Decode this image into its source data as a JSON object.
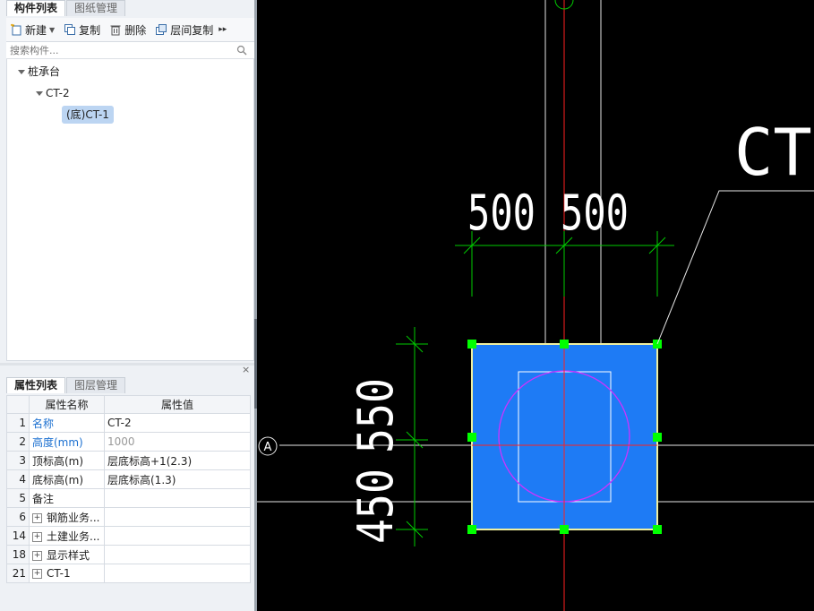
{
  "component_panel": {
    "tabs": [
      {
        "label": "构件列表",
        "active": true
      },
      {
        "label": "图纸管理",
        "active": false
      }
    ],
    "toolbar": {
      "new_label": "新建",
      "copy_label": "复制",
      "delete_label": "删除",
      "floor_copy_label": "层间复制"
    },
    "search": {
      "placeholder": "搜索构件..."
    },
    "tree": {
      "root": "桩承台",
      "child": "CT-2",
      "selected_leaf": "(底)CT-1"
    }
  },
  "property_panel": {
    "tabs": [
      {
        "label": "属性列表",
        "active": true
      },
      {
        "label": "图层管理",
        "active": false
      }
    ],
    "headers": {
      "name": "属性名称",
      "value": "属性值"
    },
    "rows": [
      {
        "num": "1",
        "name": "名称",
        "value": "CT-2",
        "style": "blue"
      },
      {
        "num": "2",
        "name": "高度(mm)",
        "value": "1000",
        "style": "blue-gray"
      },
      {
        "num": "3",
        "name": "顶标高(m)",
        "value": "层底标高+1(2.3)",
        "style": ""
      },
      {
        "num": "4",
        "name": "底标高(m)",
        "value": "层底标高(1.3)",
        "style": ""
      },
      {
        "num": "5",
        "name": "备注",
        "value": "",
        "style": ""
      },
      {
        "num": "6",
        "name": "钢筋业务...",
        "value": "",
        "style": "group"
      },
      {
        "num": "14",
        "name": "土建业务...",
        "value": "",
        "style": "group"
      },
      {
        "num": "18",
        "name": "显示样式",
        "value": "",
        "style": "group"
      },
      {
        "num": "21",
        "name": "CT-1",
        "value": "",
        "style": "group"
      }
    ]
  },
  "cad": {
    "label_ct": "CT-",
    "dim_top_left": "500",
    "dim_top_right": "500",
    "dim_left_top": "550",
    "dim_left_bottom": "450",
    "axis_label": "A",
    "colors": {
      "background": "#000000",
      "fill": "#1e7bf5",
      "grip": "#00ff00",
      "axis": "#ff2020",
      "dimension": "#00cc00",
      "circle": "#cc33ff"
    }
  }
}
